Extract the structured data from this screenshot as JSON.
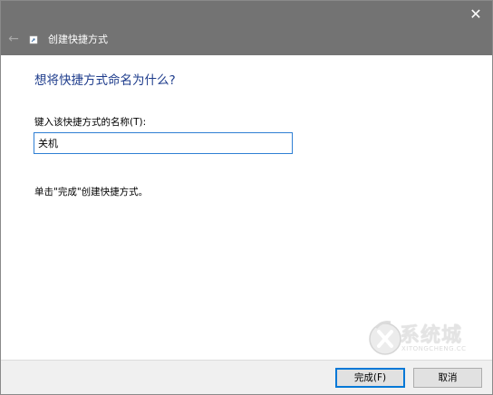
{
  "window": {
    "title": "创建快捷方式",
    "close_glyph": "✕",
    "back_glyph": "←"
  },
  "content": {
    "heading": "想将快捷方式命名为什么?",
    "name_label": "键入该快捷方式的名称(T):",
    "name_value": "关机",
    "hint": "单击\"完成\"创建快捷方式。"
  },
  "buttons": {
    "finish_label": "完成(F)",
    "cancel_label": "取消"
  },
  "watermark": {
    "text": "系统城",
    "sub": "XITONGCHENG.CC"
  },
  "colors": {
    "titlebar": "#737373",
    "heading": "#1e3c8c",
    "input_border": "#2f7fd4",
    "default_button_border": "#0078d7"
  }
}
